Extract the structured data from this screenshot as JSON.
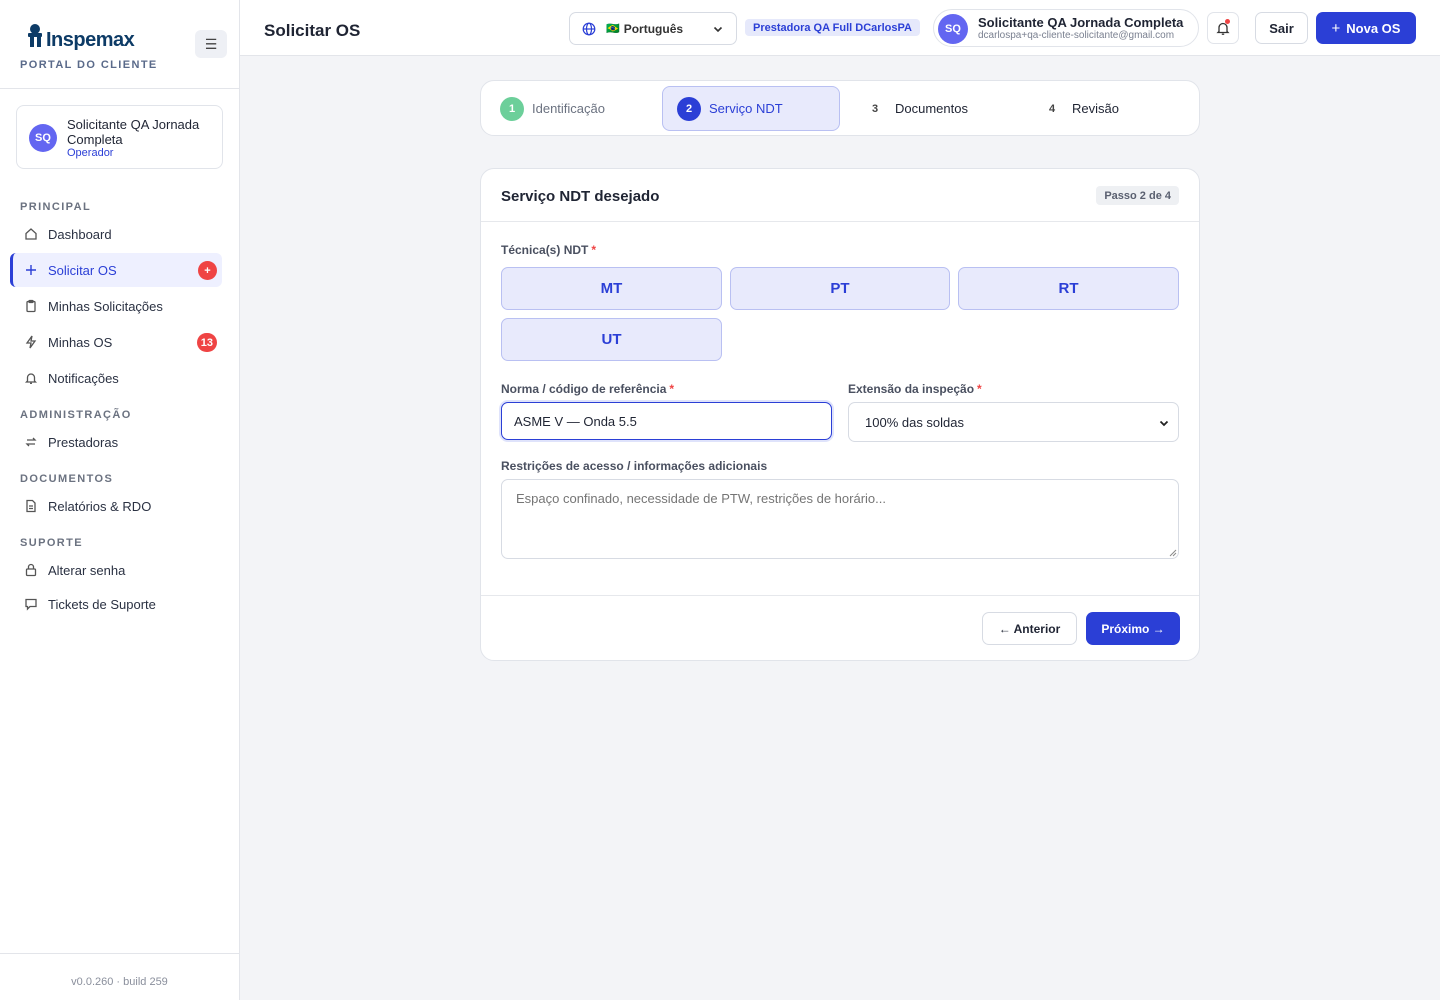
{
  "brand": {
    "name": "Inspemax",
    "subtitle": "PORTAL DO CLIENTE",
    "menu_icon": "hamburger-icon"
  },
  "sidebar": {
    "user": {
      "initials": "SQ",
      "name": "Solicitante QA Jornada Completa",
      "role": "Operador"
    },
    "sections": [
      {
        "title": "PRINCIPAL",
        "items": [
          {
            "label": "Dashboard",
            "icon": "home-icon"
          },
          {
            "label": "Solicitar OS",
            "icon": "plus-icon",
            "active": true,
            "badge": "+"
          },
          {
            "label": "Minhas Solicitações",
            "icon": "clipboard-icon"
          },
          {
            "label": "Minhas OS",
            "icon": "lightning-icon",
            "badge": "13"
          },
          {
            "label": "Notificações",
            "icon": "bell-icon"
          }
        ]
      },
      {
        "title": "ADMINISTRAÇÃO",
        "items": [
          {
            "label": "Prestadoras",
            "icon": "swap-icon"
          }
        ]
      },
      {
        "title": "DOCUMENTOS",
        "items": [
          {
            "label": "Relatórios & RDO",
            "icon": "document-icon"
          }
        ]
      },
      {
        "title": "SUPORTE",
        "items": [
          {
            "label": "Alterar senha",
            "icon": "lock-icon"
          },
          {
            "label": "Tickets de Suporte",
            "icon": "chat-icon"
          }
        ]
      }
    ],
    "version": "v0.0.260 · build 259"
  },
  "header": {
    "title": "Solicitar OS",
    "language": {
      "flag": "🇧🇷",
      "label": "Português"
    },
    "tenant": "Prestadora QA Full DCarlosPA",
    "user": {
      "initials": "SQ",
      "name": "Solicitante QA Jornada Completa",
      "email": "dcarlospa+qa-cliente-solicitante@gmail.com"
    },
    "logout_label": "Sair",
    "new_os_label": "Nova OS",
    "colors": {
      "accent": "#2b3fd6",
      "alert": "#ef4444",
      "done": "#6ccf9a"
    }
  },
  "stepper": {
    "steps": [
      {
        "num": "1",
        "label": "Identificação",
        "state": "done"
      },
      {
        "num": "2",
        "label": "Serviço NDT",
        "state": "current"
      },
      {
        "num": "3",
        "label": "Documentos",
        "state": "todo"
      },
      {
        "num": "4",
        "label": "Revisão",
        "state": "todo"
      }
    ]
  },
  "form": {
    "title": "Serviço NDT desejado",
    "step_indicator": "Passo 2 de 4",
    "techniques_label": "Técnica(s) NDT",
    "required_mark": "*",
    "techniques": [
      "MT",
      "PT",
      "RT",
      "UT"
    ],
    "norma_label": "Norma / código de referência",
    "norma_value": "ASME V — Onda 5.5",
    "extensao_label": "Extensão da inspeção",
    "extensao_value": "100% das soldas",
    "restricoes_label": "Restrições de acesso / informações adicionais",
    "restricoes_placeholder": "Espaço confinado, necessidade de PTW, restrições de horário...",
    "prev_label": "← Anterior",
    "next_label": "Próximo →"
  }
}
